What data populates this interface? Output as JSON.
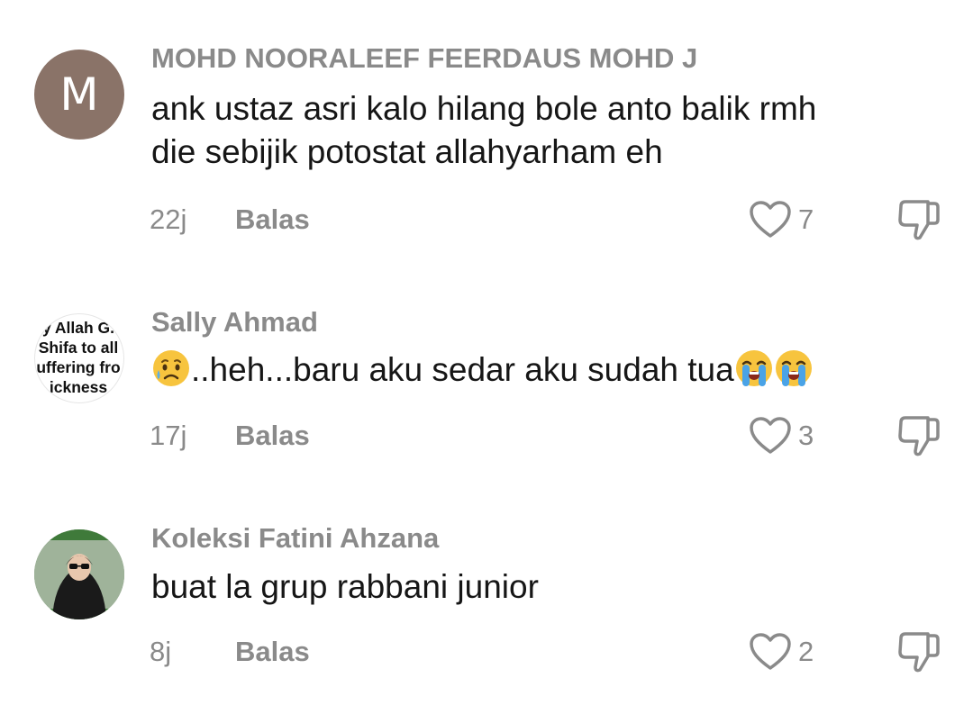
{
  "comments": [
    {
      "avatar_letter": "M",
      "username": "MOHD NOORALEEF FEERDAUS MOHD J",
      "text_lines": [
        "ank ustaz asri kalo hilang bole anto balik rmh",
        "die sebijik potostat allahyarham eh"
      ],
      "time": "22j",
      "reply_label": "Balas",
      "likes": "7"
    },
    {
      "avatar_text": [
        "y Allah G.",
        "Shifa to all",
        "uffering fro",
        "ickness"
      ],
      "username": "Sally Ahmad",
      "text": "..heh...baru aku sedar aku sudah tua",
      "time": "17j",
      "reply_label": "Balas",
      "likes": "3"
    },
    {
      "username": "Koleksi Fatini Ahzana",
      "text": "buat la grup rabbani junior",
      "time": "8j",
      "reply_label": "Balas",
      "likes": "2"
    }
  ],
  "colors": {
    "muted": "#8a8a8a",
    "text": "#161616",
    "avatar_m": "#8a7368"
  },
  "icons": [
    "heart-outline-icon",
    "thumbs-down-outline-icon",
    "sad-relieved-face-emoji",
    "loudly-crying-face-emoji"
  ]
}
